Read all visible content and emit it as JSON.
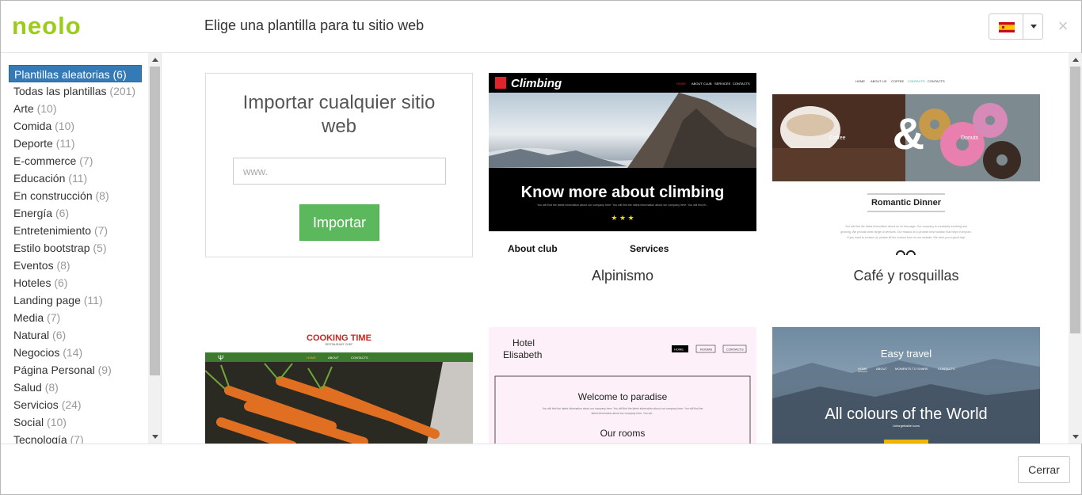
{
  "header": {
    "logo_text": "neolo",
    "title": "Elige una plantilla para tu sitio web",
    "language": "es-flag-icon",
    "close_symbol": "×"
  },
  "sidebar": {
    "items": [
      {
        "label": "Plantillas aleatorias",
        "count": "(6)",
        "active": true
      },
      {
        "label": "Todas las plantillas",
        "count": "(201)"
      },
      {
        "label": "Arte",
        "count": "(10)"
      },
      {
        "label": "Comida",
        "count": "(10)"
      },
      {
        "label": "Deporte",
        "count": "(11)"
      },
      {
        "label": "E-commerce",
        "count": "(7)"
      },
      {
        "label": "Educación",
        "count": "(11)"
      },
      {
        "label": "En construcción",
        "count": "(8)"
      },
      {
        "label": "Energía",
        "count": "(6)"
      },
      {
        "label": "Entretenimiento",
        "count": "(7)"
      },
      {
        "label": "Estilo bootstrap",
        "count": "(5)"
      },
      {
        "label": "Eventos",
        "count": "(8)"
      },
      {
        "label": "Hoteles",
        "count": "(6)"
      },
      {
        "label": "Landing page",
        "count": "(11)"
      },
      {
        "label": "Media",
        "count": "(7)"
      },
      {
        "label": "Natural",
        "count": "(6)"
      },
      {
        "label": "Negocios",
        "count": "(14)"
      },
      {
        "label": "Página Personal",
        "count": "(9)"
      },
      {
        "label": "Salud",
        "count": "(8)"
      },
      {
        "label": "Servicios",
        "count": "(24)"
      },
      {
        "label": "Social",
        "count": "(10)"
      },
      {
        "label": "Tecnología",
        "count": "(7)"
      }
    ]
  },
  "import": {
    "title": "Importar cualquier sitio web",
    "placeholder": "www.",
    "button": "Importar"
  },
  "templates": {
    "alpinismo": {
      "name": "Alpinismo",
      "brand": "Climbing",
      "nav": [
        "HOME",
        "ABOUT CLUB",
        "SERVICES",
        "CONTACTS"
      ],
      "headline": "Know more about climbing",
      "body": "You will find the latest information about our company here. You will find the latest information about our company here. You will find th...",
      "col1": "About club",
      "col2": "Services"
    },
    "cafe": {
      "name": "Café y rosquillas",
      "nav": [
        "HOME",
        "ABOUT US",
        "COFFEE",
        "CONTACTS",
        "CONTACTS"
      ],
      "left_label": "Coffee",
      "ampersand": "&",
      "right_label": "Donuts",
      "heading": "Romantic Dinner",
      "body1": "You will find the latest information about us on this page. Our company is constantly evolving and",
      "body2": "growing. We provide wide range of services. Our mission is to provide best solution that helps everyone.",
      "body3": "If you want to contact us, please fill the contact form on our website. We wish you a good day!"
    },
    "cooking": {
      "brand": "COOKING TIME",
      "sub": "RESTAURANT CHEF",
      "nav": [
        "HOME",
        "ABOUT",
        "CONTACTS"
      ]
    },
    "hotel": {
      "brand1": "Hotel",
      "brand2": "Elisabeth",
      "nav": [
        "HOME",
        "ROOMS",
        "CONTACTS"
      ],
      "welcome": "Welcome to paradise",
      "body": "You will find the latest information about our company here. You will find the latest information about our company here. You will find the",
      "body2": "latest information about our company here. You wil...",
      "rooms": "Our rooms"
    },
    "travel": {
      "brand": "Easy travel",
      "nav": [
        "HOME",
        "ABOUT",
        "MOMENTS TO SHARE",
        "CONTACTS"
      ],
      "headline": "All colours of the World",
      "sub": "Unforgettable tours"
    }
  },
  "footer": {
    "close_button": "Cerrar"
  },
  "colors": {
    "logo": "#9ccc1a",
    "active_item": "#337ab7",
    "import_button": "#5cb85c"
  }
}
